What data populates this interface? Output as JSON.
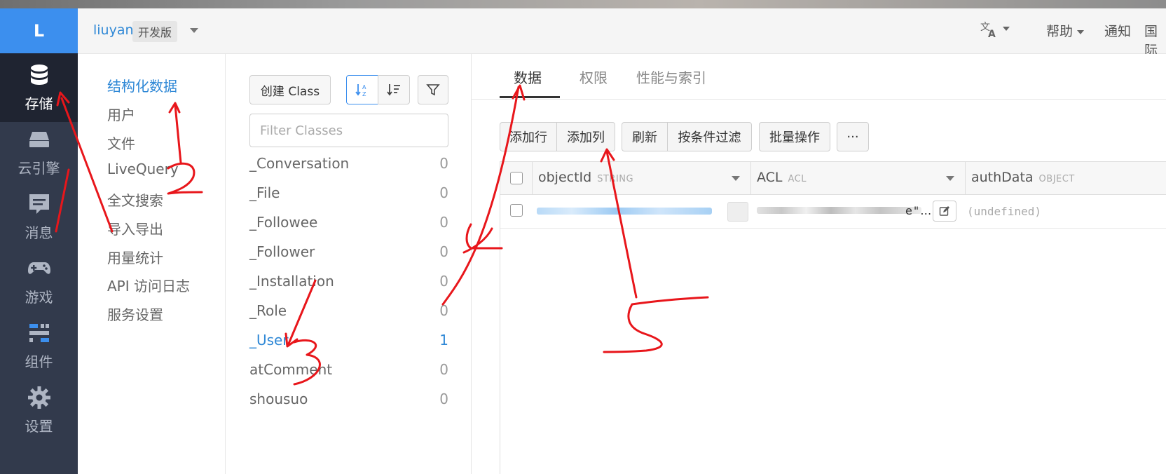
{
  "rail": {
    "logo": "L",
    "items": [
      {
        "label": "存储",
        "icon": "database-icon",
        "active": true
      },
      {
        "label": "云引擎",
        "icon": "server-icon"
      },
      {
        "label": "消息",
        "icon": "message-icon"
      },
      {
        "label": "游戏",
        "icon": "gamepad-icon"
      },
      {
        "label": "组件",
        "icon": "components-icon"
      },
      {
        "label": "设置",
        "icon": "gear-icon"
      }
    ]
  },
  "header": {
    "app_name": "liuyan",
    "edition": "开发版",
    "language_icon": "translate-icon",
    "help": "帮助",
    "notify": "通知",
    "intl": "国际"
  },
  "nav": {
    "items": [
      "结构化数据",
      "用户",
      "文件",
      "LiveQuery",
      "全文搜索",
      "导入导出",
      "用量统计",
      "API 访问日志",
      "服务设置"
    ],
    "active": "结构化数据"
  },
  "classes": {
    "create_label": "创建 Class",
    "filter_placeholder": "Filter Classes",
    "list": [
      {
        "name": "_Conversation",
        "count": "0"
      },
      {
        "name": "_File",
        "count": "0"
      },
      {
        "name": "_Followee",
        "count": "0"
      },
      {
        "name": "_Follower",
        "count": "0"
      },
      {
        "name": "_Installation",
        "count": "0"
      },
      {
        "name": "_Role",
        "count": "0"
      },
      {
        "name": "_User",
        "count": "1",
        "active": true
      },
      {
        "name": "atComment",
        "count": "0"
      },
      {
        "name": "shousuo",
        "count": "0"
      }
    ]
  },
  "main": {
    "tabs": [
      "数据",
      "权限",
      "性能与索引"
    ],
    "toolbar": {
      "add_row": "添加行",
      "add_col": "添加列",
      "refresh": "刷新",
      "filter": "按条件过滤",
      "batch": "批量操作",
      "more": "···"
    },
    "columns": [
      {
        "name": "objectId",
        "type": "STRING"
      },
      {
        "name": "ACL",
        "type": "ACL"
      },
      {
        "name": "authData",
        "type": "OBJECT"
      }
    ],
    "row": {
      "acl_tail": "e\"…",
      "auth_data": "(undefined)"
    }
  },
  "colors": {
    "accent": "#3c8fee",
    "rail_bg": "#323a4c",
    "annotation": "#e8161b"
  },
  "annotations": [
    "2",
    "3",
    "4",
    "5"
  ]
}
